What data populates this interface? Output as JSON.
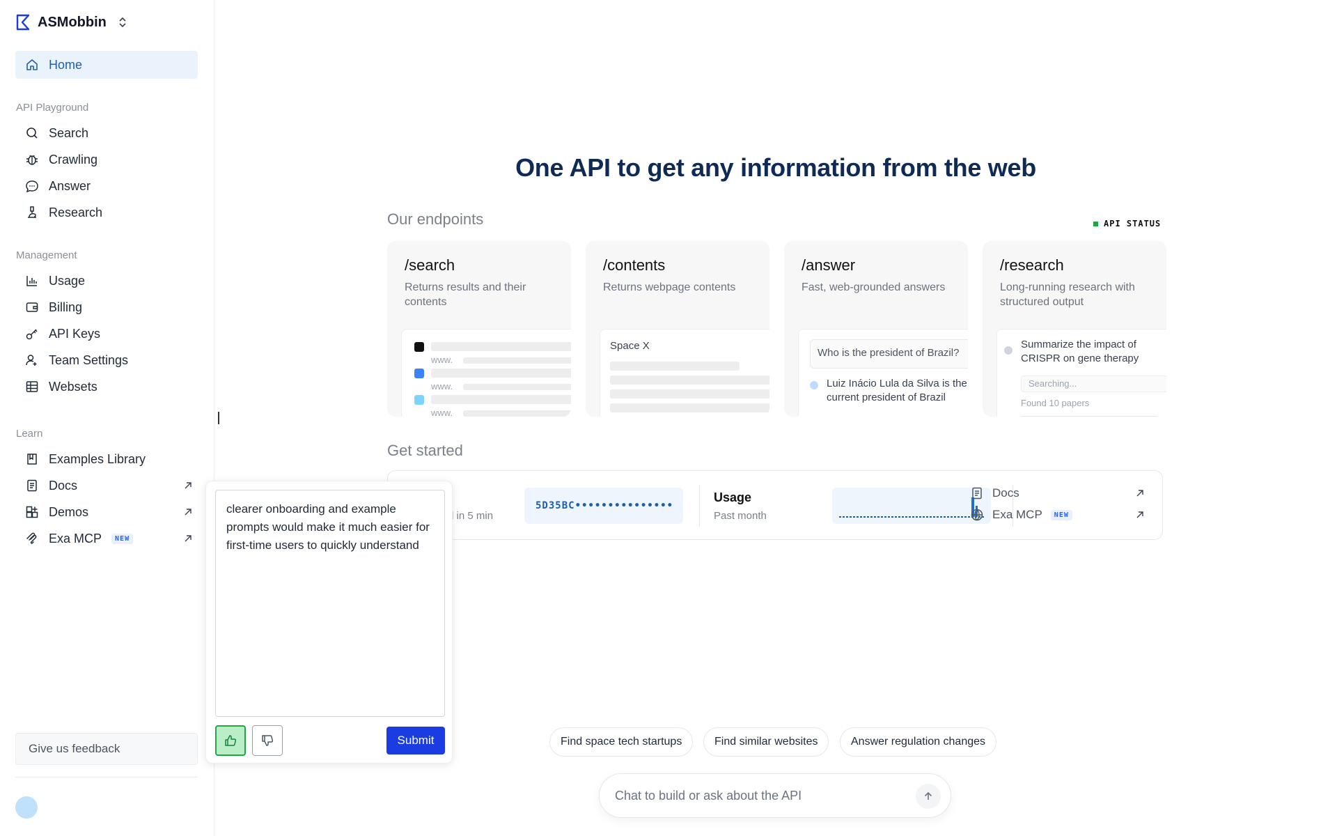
{
  "brand": {
    "name": "ASMobbin"
  },
  "nav": {
    "home": "Home",
    "sections": {
      "playground": "API Playground",
      "management": "Management",
      "learn": "Learn"
    },
    "playground": [
      "Search",
      "Crawling",
      "Answer",
      "Research"
    ],
    "management": [
      "Usage",
      "Billing",
      "API Keys",
      "Team Settings",
      "Websets"
    ],
    "learn": [
      "Examples Library",
      "Docs",
      "Demos",
      "Exa MCP"
    ],
    "new_badge": "NEW",
    "feedback": "Give us feedback"
  },
  "main": {
    "headline": "One API to get any information from the web",
    "endpoints_heading": "Our endpoints",
    "api_status": "API STATUS",
    "cards": [
      {
        "title": "/search",
        "desc": "Returns results and their contents",
        "www": "www."
      },
      {
        "title": "/contents",
        "desc": "Returns webpage contents",
        "preview": "Space X"
      },
      {
        "title": "/answer",
        "desc": "Fast, web-grounded answers",
        "question": "Who is the president of Brazil?",
        "reply": "Luiz Inácio Lula da Silva is the current president of Brazil"
      },
      {
        "title": "/research",
        "desc": "Long-running research with structured output",
        "task": "Summarize the impact of CRISPR on gene therapy",
        "status": "Searching...",
        "found": "Found 10 papers"
      }
    ],
    "get_started_heading": "Get started",
    "get_started": {
      "partial_text": "d in 5 min",
      "api_key": "5D35BC•••••••••••••••",
      "usage_title": "Usage",
      "usage_sub": "Past month",
      "docs": "Docs",
      "mcp": "Exa MCP"
    },
    "chips": [
      "Find space tech startups",
      "Find similar websites",
      "Answer regulation changes"
    ],
    "chat_placeholder": "Chat to build or ask about the API"
  },
  "feedback_popup": {
    "text": "clearer onboarding and example prompts would make it much easier for first-time users to quickly understand",
    "submit": "Submit"
  },
  "colors": {
    "accent": "#1b3ce0",
    "brand_blue": "#1f5fa8",
    "status_green": "#22a447",
    "highlight": "#eaf3fc"
  }
}
